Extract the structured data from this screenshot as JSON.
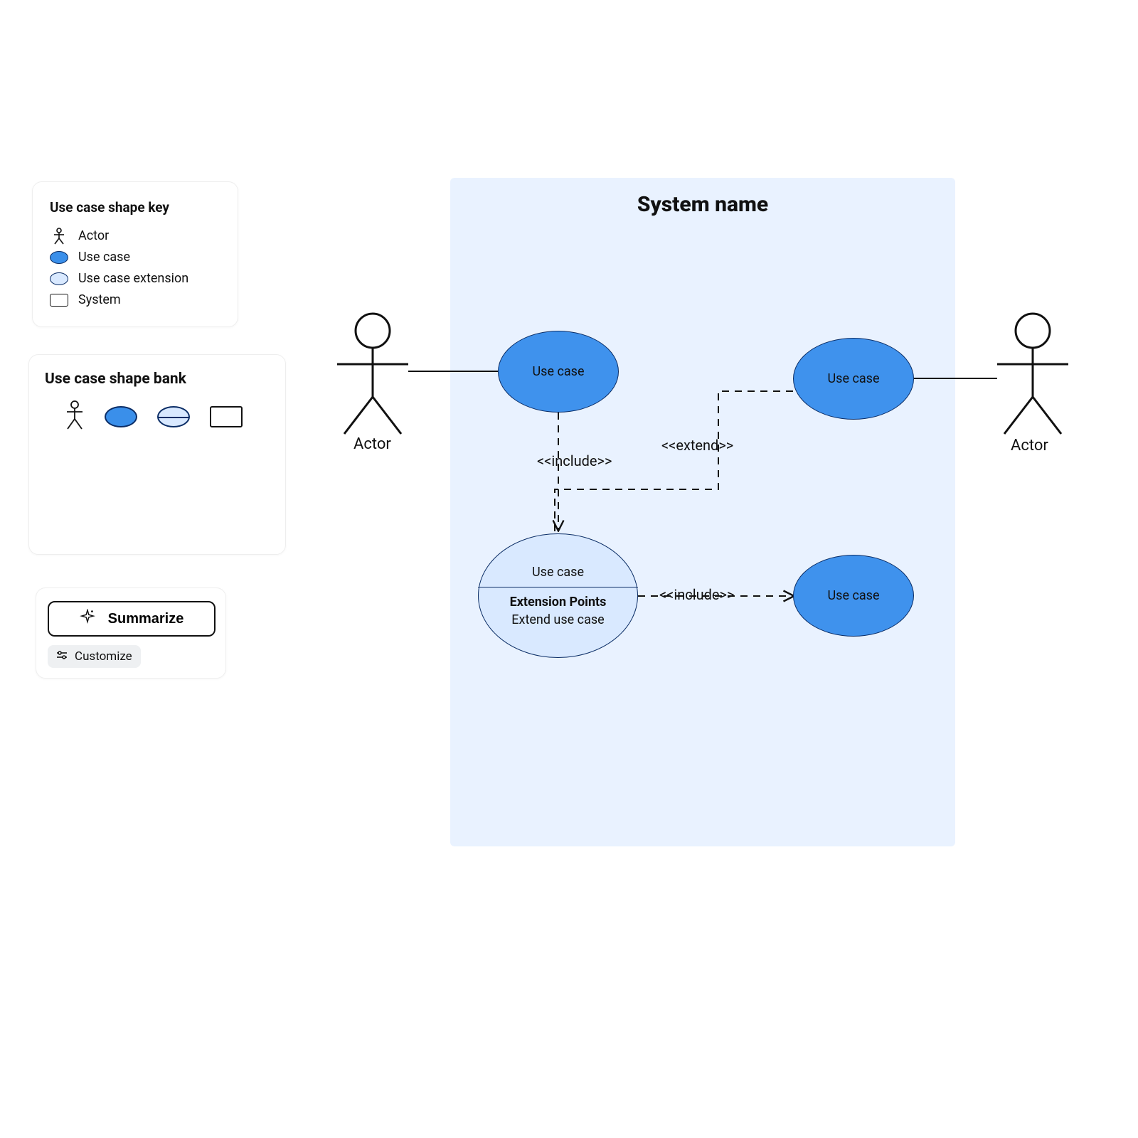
{
  "key": {
    "title": "Use case shape key",
    "actor": "Actor",
    "usecase": "Use case",
    "extension": "Use case extension",
    "system": "System"
  },
  "bank": {
    "title": "Use case shape bank"
  },
  "actions": {
    "summarize": "Summarize",
    "customize": "Customize"
  },
  "diagram": {
    "system_title": "System name",
    "actor_left": "Actor",
    "actor_right": "Actor",
    "uc1": "Use case",
    "uc2": "Use case",
    "uc4": "Use case",
    "uc3_title": "Use case",
    "uc3_ep_header": "Extension Points",
    "uc3_ep_item": "Extend use case",
    "label_include1": "<<include>>",
    "label_extend": "<<extend>>",
    "label_include2": "<<include>>"
  }
}
